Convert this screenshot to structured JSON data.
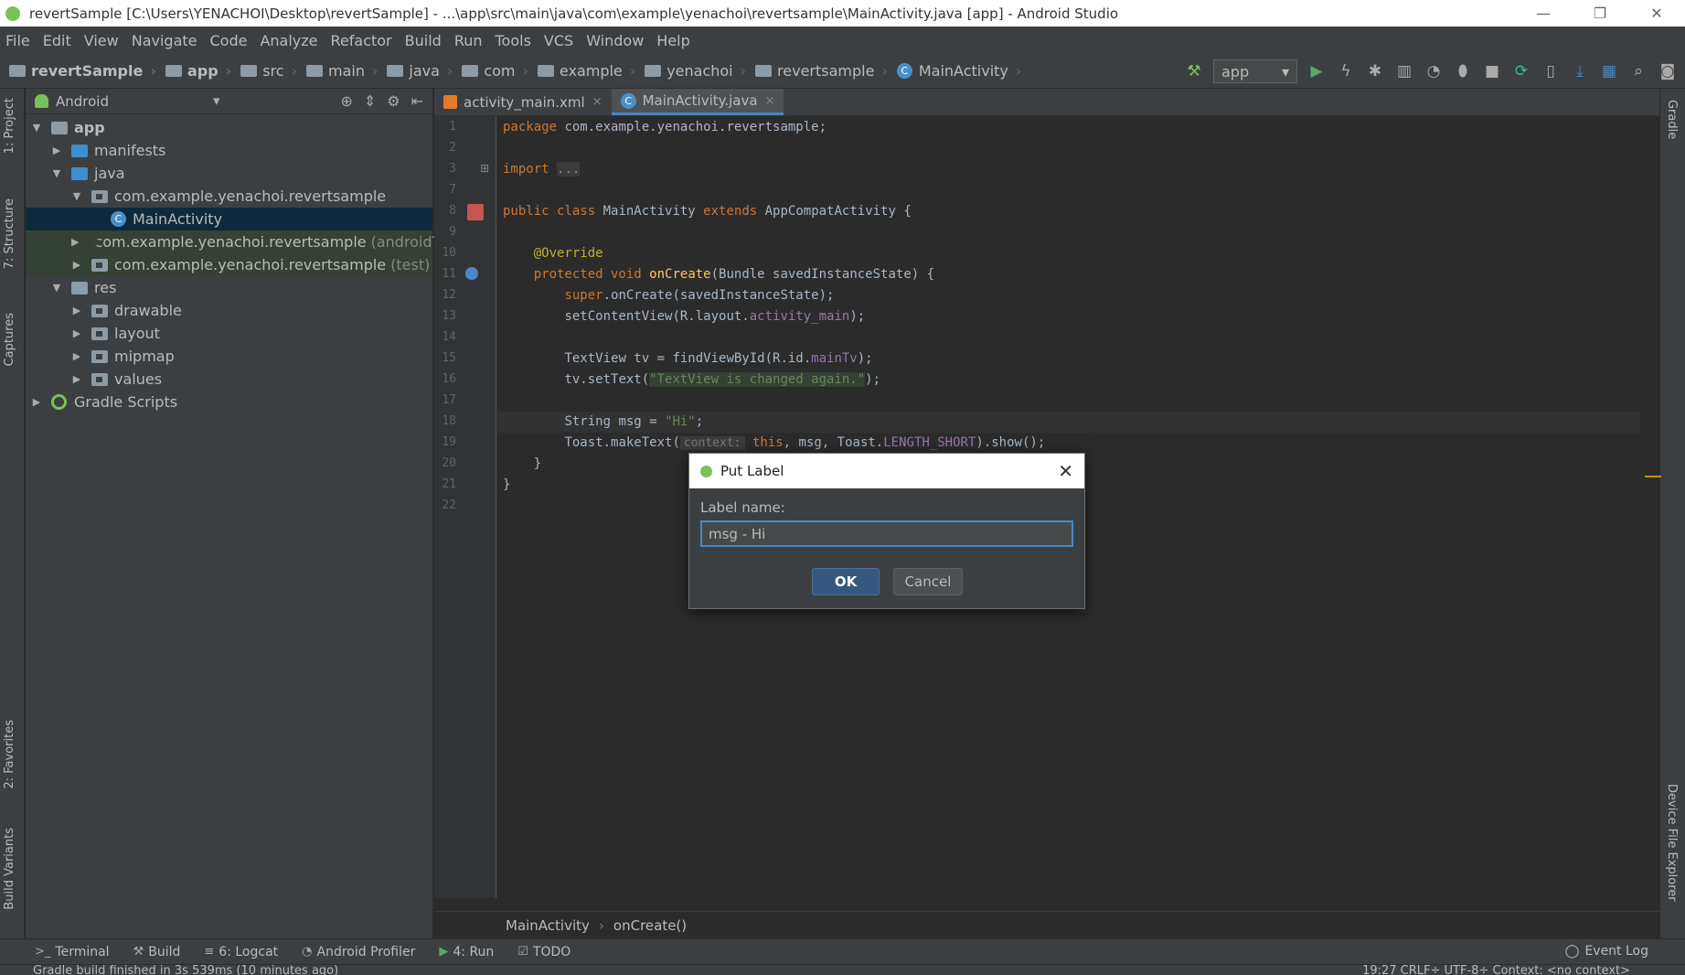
{
  "window": {
    "title": "revertSample [C:\\Users\\YENACHOI\\Desktop\\revertSample] - ...\\app\\src\\main\\java\\com\\example\\yenachoi\\revertsample\\MainActivity.java [app] - Android Studio",
    "minimize": "—",
    "maximize": "❐",
    "close": "✕"
  },
  "menu": [
    "File",
    "Edit",
    "View",
    "Navigate",
    "Code",
    "Analyze",
    "Refactor",
    "Build",
    "Run",
    "Tools",
    "VCS",
    "Window",
    "Help"
  ],
  "navbar": {
    "crumbs": [
      "revertSample",
      "app",
      "src",
      "main",
      "java",
      "com",
      "example",
      "yenachoi",
      "revertsample",
      "MainActivity"
    ],
    "run_config": "app"
  },
  "left_tabs": [
    "1: Project",
    "7: Structure",
    "Captures",
    "2: Favorites",
    "Build Variants"
  ],
  "right_tabs": [
    "Gradle",
    "Device File Explorer"
  ],
  "project_panel": {
    "view_mode": "Android",
    "tree": [
      {
        "label": "app",
        "suffix": ""
      },
      {
        "label": "manifests",
        "suffix": ""
      },
      {
        "label": "java",
        "suffix": ""
      },
      {
        "label": "com.example.yenachoi.revertsample",
        "suffix": ""
      },
      {
        "label": "MainActivity",
        "suffix": ""
      },
      {
        "label": "com.example.yenachoi.revertsample",
        "suffix": "(androidTest)"
      },
      {
        "label": "com.example.yenachoi.revertsample",
        "suffix": "(test)"
      },
      {
        "label": "res",
        "suffix": ""
      },
      {
        "label": "drawable",
        "suffix": ""
      },
      {
        "label": "layout",
        "suffix": ""
      },
      {
        "label": "mipmap",
        "suffix": ""
      },
      {
        "label": "values",
        "suffix": ""
      },
      {
        "label": "Gradle Scripts",
        "suffix": ""
      }
    ]
  },
  "editor": {
    "tabs": [
      {
        "label": "activity_main.xml",
        "close": "×"
      },
      {
        "label": "MainActivity.java",
        "close": "×"
      }
    ],
    "line_numbers": [
      "1",
      "2",
      "3",
      "7",
      "8",
      "9",
      "10",
      "11",
      "12",
      "13",
      "14",
      "15",
      "16",
      "17",
      "18",
      "19",
      "20",
      "21",
      "22"
    ],
    "code": {
      "l1_pkg": "package",
      "l1_name": " com.example.yenachoi.revertsample;",
      "l3_import": "import",
      "l3_fold": "...",
      "l8_public": "public class",
      "l8_name": " MainActivity ",
      "l8_extends": "extends",
      "l8_rest": " AppCompatActivity {",
      "l10_ann": "@Override",
      "l11_kw": "protected void",
      "l11_fn": "onCreate",
      "l11_rest": "(Bundle savedInstanceState) {",
      "l12_super": "super",
      "l12_rest": ".onCreate(savedInstanceState);",
      "l13_a": "setContentView(R.layout.",
      "l13_fld": "activity_main",
      "l13_b": ");",
      "l15_a": "TextView tv = findViewById(R.id.",
      "l15_fld": "mainTv",
      "l15_b": ");",
      "l16_a": "tv.setText(",
      "l16_str": "\"TextView is changed again.\"",
      "l16_b": ");",
      "l18_a": "String msg = ",
      "l18_str": "\"Hi\"",
      "l18_b": ";",
      "l19_a": "Toast.makeText(",
      "l19_hint": "context:",
      "l19_this": "this",
      "l19_b": ", msg, Toast.",
      "l19_fld": "LENGTH_SHORT",
      "l19_c": ").show();",
      "l20": "}",
      "l21": "}"
    },
    "breadcrumb": [
      "MainActivity",
      "onCreate()"
    ]
  },
  "bottom_tools": [
    {
      "icon": ">_",
      "label": "Terminal"
    },
    {
      "icon": "⚒",
      "label": "Build"
    },
    {
      "icon": "≡",
      "label": "6: Logcat"
    },
    {
      "icon": "◔",
      "label": "Android Profiler"
    },
    {
      "icon": "▶",
      "label": "4: Run"
    },
    {
      "icon": "☑",
      "label": "TODO"
    }
  ],
  "event_log": "Event Log",
  "statusbar": {
    "message": "Gradle build finished in 3s 539ms (10 minutes ago)",
    "right": "19:27  CRLF÷  UTF-8÷  Context: <no context>"
  },
  "dialog": {
    "title": "Put Label",
    "label": "Label name:",
    "input_value": "msg - Hi",
    "ok": "OK",
    "cancel": "Cancel",
    "close": "✕"
  },
  "colors": {
    "background": "#2b2b2b",
    "panel": "#3c3f41",
    "selection": "#0d293e",
    "accent": "#4a88c7",
    "keyword": "#cc7832",
    "string": "#6a8759"
  }
}
